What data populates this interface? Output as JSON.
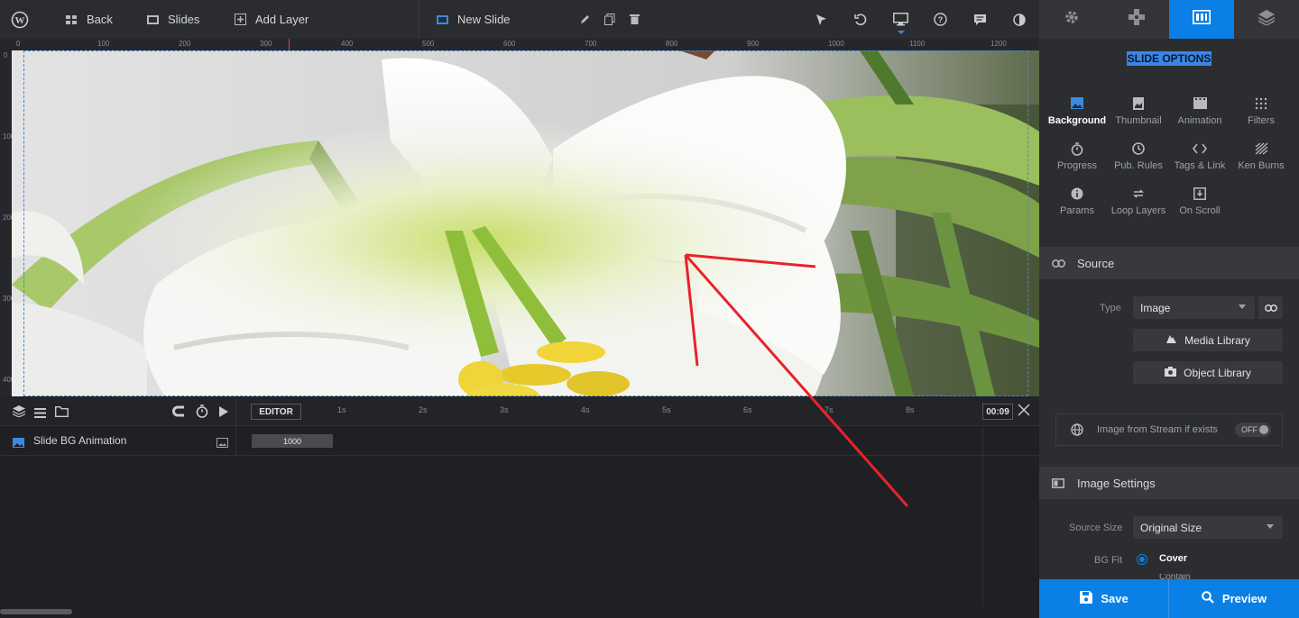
{
  "topbar": {
    "back_label": "Back",
    "slides_label": "Slides",
    "add_layer_label": "Add Layer",
    "slide_name": "New Slide"
  },
  "ruler": {
    "h_ticks": [
      "0",
      "100",
      "200",
      "300",
      "400",
      "500",
      "600",
      "700",
      "800",
      "900",
      "1000",
      "1100",
      "1200"
    ],
    "v_ticks": [
      "0",
      "100",
      "200",
      "300",
      "400"
    ]
  },
  "timeline": {
    "editor_label": "EDITOR",
    "ticks": [
      "1s",
      "2s",
      "3s",
      "4s",
      "5s",
      "6s",
      "7s",
      "8s"
    ],
    "time_display": "00:09",
    "layer_name": "Slide BG Animation",
    "bar_value": "1000"
  },
  "sidebar": {
    "title": "SLIDE OPTIONS",
    "options": [
      "Background",
      "Thumbnail",
      "Animation",
      "Filters",
      "Progress",
      "Pub. Rules",
      "Tags & Link",
      "Ken Burns",
      "Params",
      "Loop Layers",
      "On Scroll"
    ],
    "source_section": "Source",
    "type_label": "Type",
    "type_value": "Image",
    "media_library": "Media Library",
    "object_library": "Object Library",
    "stream_label": "Image from Stream if exists",
    "stream_toggle": "OFF",
    "image_settings_section": "Image Settings",
    "source_size_label": "Source Size",
    "source_size_value": "Original Size",
    "bg_fit_label": "BG Fit",
    "bg_fit_value": "Cover",
    "bg_fit_next": "Contain",
    "save_label": "Save",
    "preview_label": "Preview"
  },
  "colors": {
    "accent": "#0a7fe6",
    "annotation": "#e8232a"
  }
}
